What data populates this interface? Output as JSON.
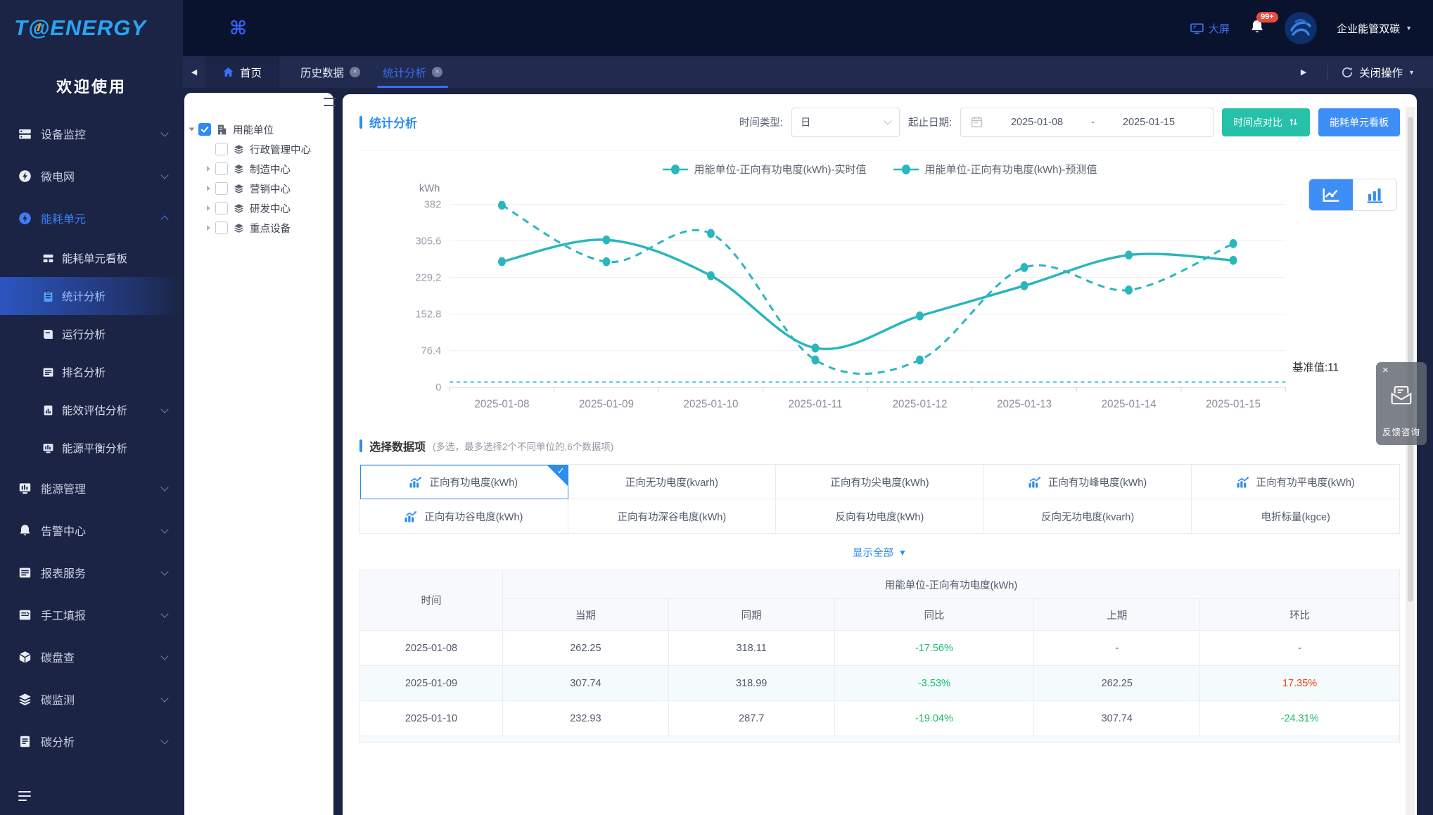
{
  "sidebar": {
    "logo_t": "T",
    "logo_at": "@",
    "logo_rest": "ENERGY",
    "welcome": "欢迎使用",
    "menu": [
      {
        "name": "device-monitoring",
        "icon": "devices-icon",
        "label": "设备监控",
        "chevron": "down"
      },
      {
        "name": "microgrid",
        "icon": "bolt-circle-icon",
        "label": "微电网",
        "chevron": "down"
      },
      {
        "name": "energy-unit",
        "icon": "bolt-circle-icon",
        "label": "能耗单元",
        "chevron": "up",
        "active": true,
        "children": [
          {
            "name": "energy-unit-board",
            "icon": "kanban-icon",
            "label": "能耗单元看板"
          },
          {
            "name": "stats-analysis",
            "icon": "clipboard-icon",
            "label": "统计分析",
            "active": true
          },
          {
            "name": "run-analysis",
            "icon": "book-icon",
            "label": "运行分析"
          },
          {
            "name": "rank-analysis",
            "icon": "list-icon",
            "label": "排名分析"
          },
          {
            "name": "energy-eval-analysis",
            "icon": "doc-chart-icon",
            "label": "能效评估分析",
            "chevron": "down"
          },
          {
            "name": "energy-balance-analysis",
            "icon": "monitor-chart-icon",
            "label": "能源平衡分析"
          }
        ]
      },
      {
        "name": "energy-mgmt",
        "icon": "monitor-chart-icon",
        "label": "能源管理",
        "chevron": "down"
      },
      {
        "name": "alarm-center",
        "icon": "bell-icon",
        "label": "告警中心",
        "chevron": "down"
      },
      {
        "name": "report-service",
        "icon": "list-icon",
        "label": "报表服务",
        "chevron": "down"
      },
      {
        "name": "manual-report",
        "icon": "form-icon",
        "label": "手工填报",
        "chevron": "down"
      },
      {
        "name": "carbon-inventory",
        "icon": "cube-icon",
        "label": "碳盘查",
        "chevron": "down"
      },
      {
        "name": "carbon-monitor",
        "icon": "layers-icon",
        "label": "碳监测",
        "chevron": "down"
      },
      {
        "name": "carbon-analysis",
        "icon": "doc-icon",
        "label": "碳分析",
        "chevron": "down"
      }
    ]
  },
  "topbar": {
    "screen_label": "大屏",
    "notification_badge": "99+",
    "org_label": "企业能管双碳"
  },
  "tabbar": {
    "home_label": "首页",
    "tabs": [
      {
        "name": "history-data",
        "label": "历史数据",
        "active": false
      },
      {
        "name": "stats-analysis",
        "label": "统计分析",
        "active": true
      }
    ],
    "close_ops_label": "关闭操作"
  },
  "tree": {
    "nodes": [
      {
        "name": "energy-org",
        "label": "用能单位",
        "icon": "org-icon",
        "checked": true,
        "caret": "open",
        "child": false
      },
      {
        "name": "admin-center",
        "label": "行政管理中心",
        "icon": "layers-sm-icon",
        "checked": false,
        "caret": "none",
        "child": true
      },
      {
        "name": "manufacture-center",
        "label": "制造中心",
        "icon": "layers-sm-icon",
        "checked": false,
        "caret": "closed",
        "child": true
      },
      {
        "name": "marketing-center",
        "label": "营销中心",
        "icon": "layers-sm-icon",
        "checked": false,
        "caret": "closed",
        "child": true
      },
      {
        "name": "rd-center",
        "label": "研发中心",
        "icon": "layers-sm-icon",
        "checked": false,
        "caret": "closed",
        "child": true
      },
      {
        "name": "key-equipment",
        "label": "重点设备",
        "icon": "layers-sm-icon",
        "checked": false,
        "caret": "closed",
        "child": true
      }
    ]
  },
  "panel": {
    "title": "统计分析",
    "time_type_label": "时间类型:",
    "time_type_value": "日",
    "date_label": "起止日期:",
    "date_start": "2025-01-08",
    "date_separator": "-",
    "date_end": "2025-01-15",
    "compare_button": "时间点对比",
    "kanban_button": "能耗单元看板"
  },
  "chart_data": {
    "type": "line",
    "ylabel": "kWh",
    "categories": [
      "2025-01-08",
      "2025-01-09",
      "2025-01-10",
      "2025-01-11",
      "2025-01-12",
      "2025-01-13",
      "2025-01-14",
      "2025-01-15"
    ],
    "yticks": [
      "0",
      "76.4",
      "152.8",
      "229.2",
      "305.6",
      "382"
    ],
    "ylim": [
      0,
      382
    ],
    "grid": true,
    "legend_position": "top",
    "series": [
      {
        "name": "用能单位-正向有功电度(kWh)-实时值",
        "style": "solid",
        "color": "#29b6bd",
        "values": [
          262.25,
          307.74,
          232.93,
          82,
          149,
          212,
          276,
          265
        ]
      },
      {
        "name": "用能单位-正向有功电度(kWh)-预测值",
        "style": "dashed",
        "color": "#29b6bd",
        "values": [
          380,
          262,
          321,
          57,
          57,
          250,
          203,
          300
        ]
      }
    ],
    "baseline": {
      "label": "基准值:11",
      "value": 11
    }
  },
  "selector": {
    "title": "选择数据项",
    "note": "(多选，最多选择2个不同单位的,6个数据项)",
    "show_all": "显示全部",
    "items": [
      {
        "name": "forward-active-energy",
        "label": "正向有功电度(kWh)",
        "icon": true,
        "selected": true
      },
      {
        "name": "forward-reactive-energy",
        "label": "正向无功电度(kvarh)",
        "icon": false,
        "selected": false
      },
      {
        "name": "forward-active-sharp",
        "label": "正向有功尖电度(kWh)",
        "icon": false,
        "selected": false
      },
      {
        "name": "forward-active-peak",
        "label": "正向有功峰电度(kWh)",
        "icon": true,
        "selected": false
      },
      {
        "name": "forward-active-flat",
        "label": "正向有功平电度(kWh)",
        "icon": true,
        "selected": false
      },
      {
        "name": "forward-active-valley",
        "label": "正向有功谷电度(kWh)",
        "icon": true,
        "selected": false
      },
      {
        "name": "forward-active-deep-valley",
        "label": "正向有功深谷电度(kWh)",
        "icon": false,
        "selected": false
      },
      {
        "name": "reverse-active-energy",
        "label": "反向有功电度(kWh)",
        "icon": false,
        "selected": false
      },
      {
        "name": "reverse-reactive-energy",
        "label": "反向无功电度(kvarh)",
        "icon": false,
        "selected": false
      },
      {
        "name": "coal-equivalent",
        "label": "电折标量(kgce)",
        "icon": false,
        "selected": false
      }
    ]
  },
  "table": {
    "time_header": "时间",
    "group_header": "用能单位-正向有功电度(kWh)",
    "sub_headers": [
      "当期",
      "同期",
      "同比",
      "上期",
      "环比"
    ],
    "rows": [
      {
        "time": "2025-01-08",
        "cells": [
          {
            "v": "262.25"
          },
          {
            "v": "318.11"
          },
          {
            "v": "-17.56%",
            "c": "green"
          },
          {
            "v": "-"
          },
          {
            "v": "-"
          }
        ]
      },
      {
        "time": "2025-01-09",
        "cells": [
          {
            "v": "307.74"
          },
          {
            "v": "318.99"
          },
          {
            "v": "-3.53%",
            "c": "green"
          },
          {
            "v": "262.25"
          },
          {
            "v": "17.35%",
            "c": "red"
          }
        ]
      },
      {
        "time": "2025-01-10",
        "cells": [
          {
            "v": "232.93"
          },
          {
            "v": "287.7"
          },
          {
            "v": "-19.04%",
            "c": "green"
          },
          {
            "v": "307.74"
          },
          {
            "v": "-24.31%",
            "c": "green"
          }
        ]
      }
    ]
  },
  "feedback": {
    "close": "×",
    "label": "反馈咨询"
  },
  "colors": {
    "accent_blue": "#2d8cf0",
    "teal": "#29b6bd",
    "green": "#19be6b",
    "red": "#ed4014",
    "button_teal": "#25c1a9",
    "button_blue": "#3e8ef7"
  }
}
